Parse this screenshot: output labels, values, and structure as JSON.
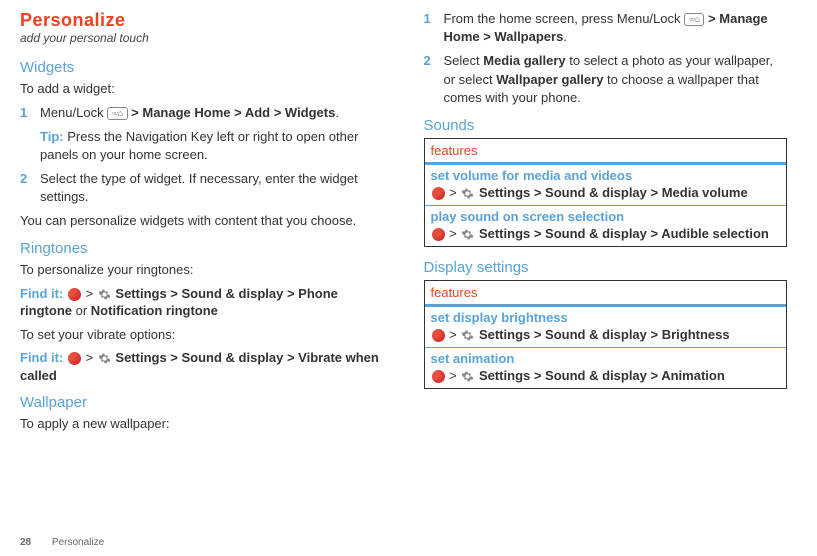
{
  "page": {
    "number": "28",
    "footer_label": "Personalize"
  },
  "left": {
    "title": "Personalize",
    "subtitle": "add your personal touch",
    "widgets": {
      "heading": "Widgets",
      "intro": "To add a widget:",
      "step1_num": "1",
      "step1_pre": "Menu/Lock ",
      "step1_path": " > Manage Home > Add > Widgets",
      "step1_end": ".",
      "tip_label": "Tip:",
      "tip_text": " Press the Navigation Key left or right to open other panels on your home screen.",
      "step2_num": "2",
      "step2_text": "Select the type of widget. If necessary, enter the widget settings.",
      "outro": "You can personalize widgets with content that you choose."
    },
    "ringtones": {
      "heading": "Ringtones",
      "intro": "To personalize your ringtones:",
      "find1_label": "Find it:",
      "find1_path": "Settings > Sound & display > Phone ringtone",
      "find1_or": " or ",
      "find1_alt": "Notification ringtone",
      "intro2": "To set your vibrate options:",
      "find2_label": "Find it:",
      "find2_path": "Settings > Sound & display > Vibrate when called"
    },
    "wallpaper": {
      "heading": "Wallpaper",
      "intro": "To apply a new wallpaper:"
    }
  },
  "right": {
    "step1_num": "1",
    "step1_pre": "From the home screen, press Menu/Lock ",
    "step1_path": " > Manage Home > Wallpapers",
    "step1_end": ".",
    "step2_num": "2",
    "step2_pre": "Select ",
    "step2_bold1": "Media gallery",
    "step2_mid": " to select a photo as your wallpaper, or select ",
    "step2_bold2": "Wallpaper gallery",
    "step2_end": " to choose a wallpaper that comes with your phone.",
    "sounds": {
      "heading": "Sounds",
      "thead": "features",
      "row1_name": "set volume for media and videos",
      "row1_path": "Settings > Sound & display > Media volume",
      "row2_name": "play sound on screen selection",
      "row2_path": "Settings > Sound & display > Audible selection"
    },
    "display": {
      "heading": "Display settings",
      "thead": "features",
      "row1_name": "set display brightness",
      "row1_path": "Settings > Sound & display > Brightness",
      "row2_name": "set animation",
      "row2_path": "Settings > Sound & display > Animation"
    }
  },
  "icons": {
    "menukey": "▫▫⌂"
  }
}
